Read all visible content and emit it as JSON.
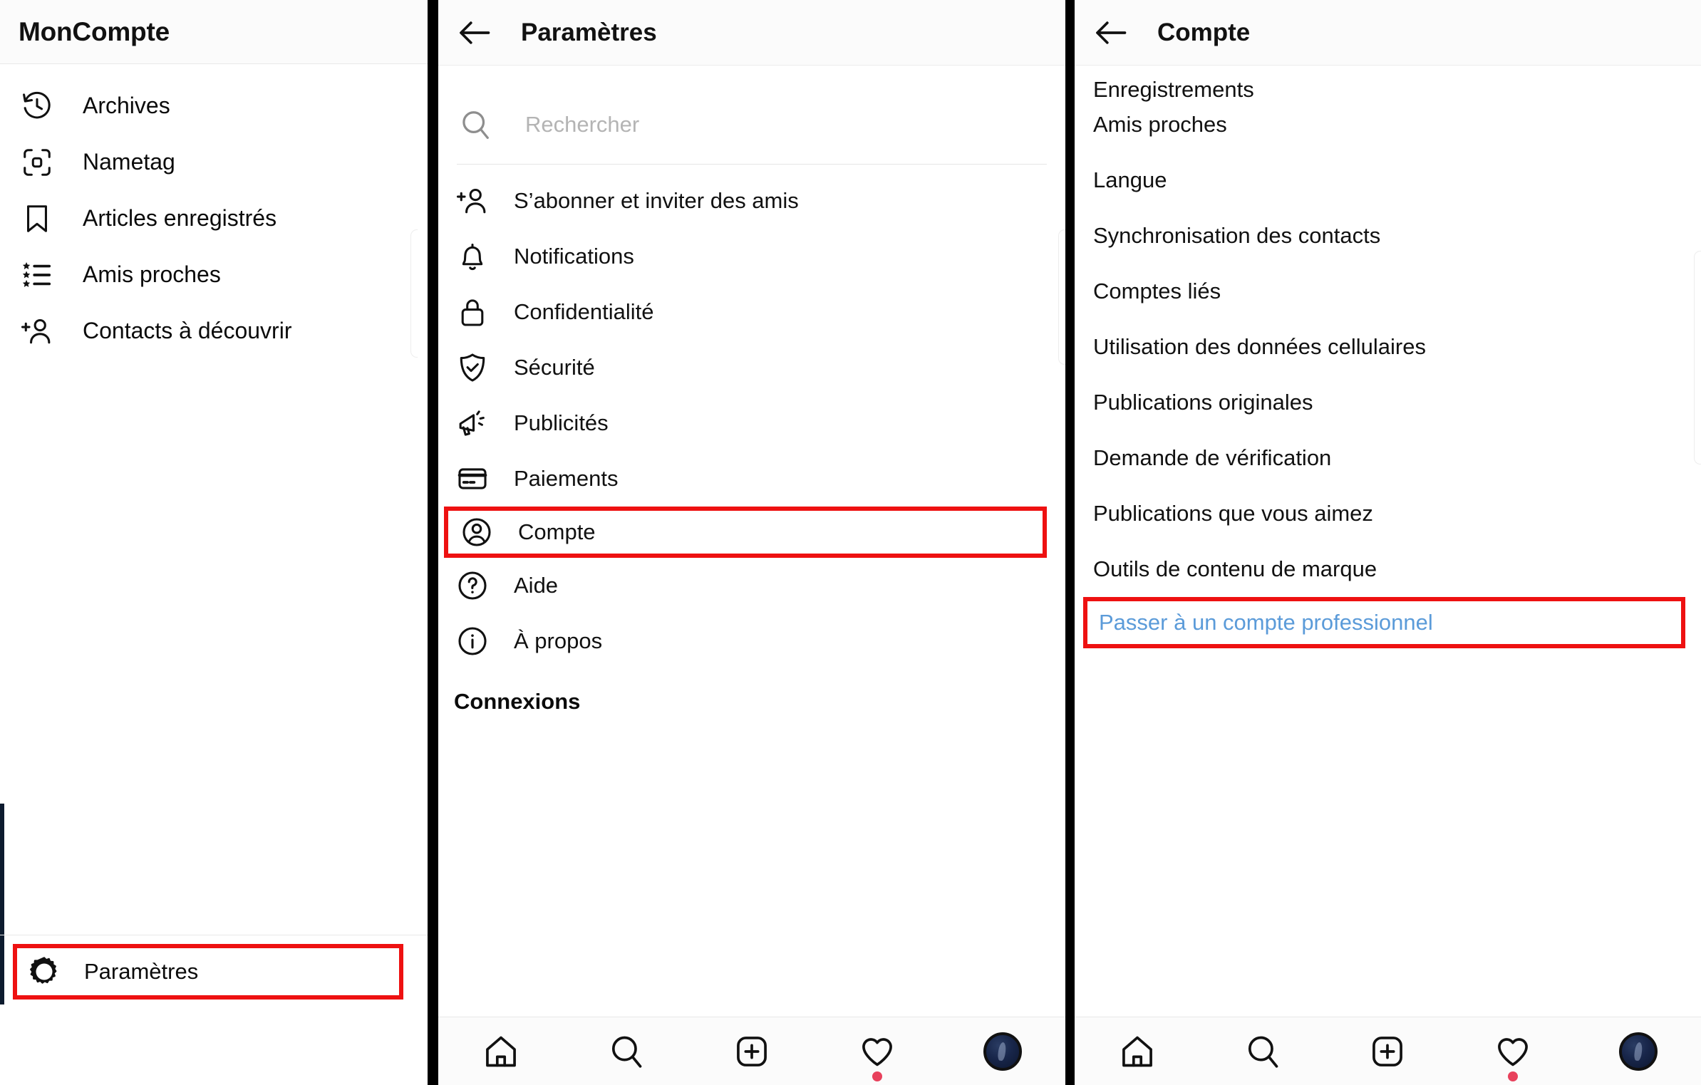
{
  "panel1": {
    "header_title": "MonCompte",
    "items": [
      {
        "label": "Archives",
        "icon": "history-clock-icon"
      },
      {
        "label": "Nametag",
        "icon": "nametag-scan-icon"
      },
      {
        "label": "Articles enregistrés",
        "icon": "bookmark-icon"
      },
      {
        "label": "Amis proches",
        "icon": "close-friends-star-list-icon"
      },
      {
        "label": "Contacts à découvrir",
        "icon": "discover-people-add-icon"
      }
    ],
    "settings": {
      "label": "Paramètres",
      "icon": "gear-icon",
      "highlight_color": "#ee1111"
    }
  },
  "panel2": {
    "back_icon": "back-arrow-icon",
    "header_title": "Paramètres",
    "search": {
      "placeholder": "Rechercher",
      "icon": "search-icon",
      "value": ""
    },
    "items": [
      {
        "label": "S’abonner et inviter des amis",
        "icon": "person-add-icon",
        "highlighted": false
      },
      {
        "label": "Notifications",
        "icon": "bell-icon",
        "highlighted": false
      },
      {
        "label": "Confidentialité",
        "icon": "lock-icon",
        "highlighted": false
      },
      {
        "label": "Sécurité",
        "icon": "shield-check-icon",
        "highlighted": false
      },
      {
        "label": "Publicités",
        "icon": "megaphone-icon",
        "highlighted": false
      },
      {
        "label": "Paiements",
        "icon": "credit-card-icon",
        "highlighted": false
      },
      {
        "label": "Compte",
        "icon": "account-circle-icon",
        "highlighted": true
      },
      {
        "label": "Aide",
        "icon": "question-circle-icon",
        "highlighted": false
      },
      {
        "label": "À propos",
        "icon": "info-circle-icon",
        "highlighted": false
      }
    ],
    "section_title": "Connexions",
    "highlight_color": "#ee1111"
  },
  "panel3": {
    "back_icon": "back-arrow-icon",
    "header_title": "Compte",
    "items": [
      {
        "label": "Enregistrements",
        "clipped": true,
        "link": false,
        "highlighted": false
      },
      {
        "label": "Amis proches",
        "clipped": false,
        "link": false,
        "highlighted": false
      },
      {
        "label": "Langue",
        "clipped": false,
        "link": false,
        "highlighted": false
      },
      {
        "label": "Synchronisation des contacts",
        "clipped": false,
        "link": false,
        "highlighted": false
      },
      {
        "label": "Comptes liés",
        "clipped": false,
        "link": false,
        "highlighted": false
      },
      {
        "label": "Utilisation des données cellulaires",
        "clipped": false,
        "link": false,
        "highlighted": false
      },
      {
        "label": "Publications originales",
        "clipped": false,
        "link": false,
        "highlighted": false
      },
      {
        "label": "Demande de vérification",
        "clipped": false,
        "link": false,
        "highlighted": false
      },
      {
        "label": "Publications que vous aimez",
        "clipped": false,
        "link": false,
        "highlighted": false
      },
      {
        "label": "Outils de contenu de marque",
        "clipped": false,
        "link": false,
        "highlighted": false
      },
      {
        "label": "Passer à un compte professionnel",
        "clipped": false,
        "link": true,
        "highlighted": true
      }
    ],
    "link_color": "#5b9bd9",
    "highlight_color": "#ee1111"
  },
  "tabbar": {
    "tabs": [
      {
        "icon": "home-icon",
        "badge": false
      },
      {
        "icon": "search-icon",
        "badge": false
      },
      {
        "icon": "add-post-icon",
        "badge": false
      },
      {
        "icon": "heart-activity-icon",
        "badge": true
      },
      {
        "icon": "profile-avatar-icon",
        "badge": false
      }
    ],
    "badge_color": "#e8415c"
  }
}
